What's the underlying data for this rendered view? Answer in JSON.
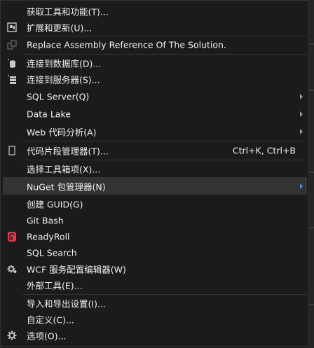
{
  "menu": {
    "items": [
      {
        "label": "获取工具和功能(T)...",
        "shortcut": "",
        "submenu": false
      },
      {
        "label": "扩展和更新(U)...",
        "shortcut": "",
        "submenu": false,
        "icon": "extensions-icon"
      },
      {
        "label": "Replace Assembly Reference Of The Solution.",
        "shortcut": "",
        "submenu": false,
        "icon": "replace-reference-icon"
      },
      {
        "label": "连接到数据库(D)...",
        "shortcut": "",
        "submenu": false,
        "icon": "connect-database-icon"
      },
      {
        "label": "连接到服务器(S)...",
        "shortcut": "",
        "submenu": false,
        "icon": "connect-server-icon"
      },
      {
        "label": "SQL Server(Q)",
        "shortcut": "",
        "submenu": true
      },
      {
        "label": "Data Lake",
        "shortcut": "",
        "submenu": true
      },
      {
        "label": "Web 代码分析(A)",
        "shortcut": "",
        "submenu": true
      },
      {
        "label": "代码片段管理器(T)...",
        "shortcut": "Ctrl+K, Ctrl+B",
        "submenu": false,
        "icon": "snippet-icon"
      },
      {
        "label": "选择工具箱项(X)...",
        "shortcut": "",
        "submenu": false
      },
      {
        "label": "NuGet 包管理器(N)",
        "shortcut": "",
        "submenu": true,
        "highlighted": true
      },
      {
        "label": "创建 GUID(G)",
        "shortcut": "",
        "submenu": false
      },
      {
        "label": "Git Bash",
        "shortcut": "",
        "submenu": false
      },
      {
        "label": "ReadyRoll",
        "shortcut": "",
        "submenu": false,
        "icon": "readyroll-icon"
      },
      {
        "label": "SQL Search",
        "shortcut": "",
        "submenu": false
      },
      {
        "label": "WCF 服务配置编辑器(W)",
        "shortcut": "",
        "submenu": false,
        "icon": "wcf-config-icon"
      },
      {
        "label": "外部工具(E)...",
        "shortcut": "",
        "submenu": false
      },
      {
        "label": "导入和导出设置(I)...",
        "shortcut": "",
        "submenu": false
      },
      {
        "label": "自定义(C)...",
        "shortcut": "",
        "submenu": false
      },
      {
        "label": "选项(O)...",
        "shortcut": "",
        "submenu": false,
        "icon": "gear-icon"
      }
    ]
  },
  "colors": {
    "background": "#1b1b1c",
    "text": "#f1f1f1",
    "highlight": "#333334",
    "accent_arrow": "#3794ff",
    "readyroll": "#e8384f"
  }
}
